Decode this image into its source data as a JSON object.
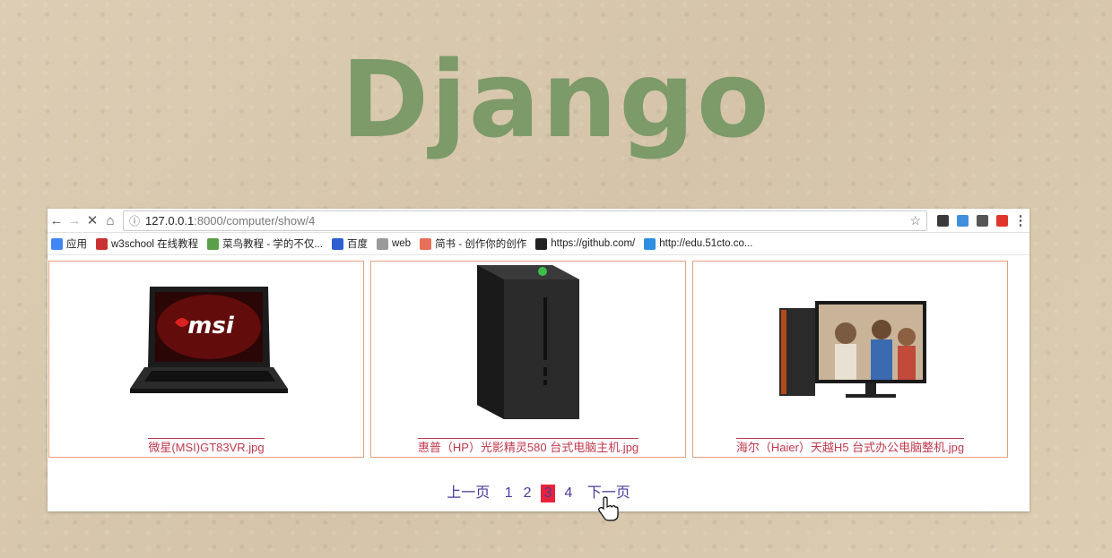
{
  "slide": {
    "title": "Django"
  },
  "browser": {
    "url_host": "127.0.0.1",
    "url_path": ":8000/computer/show/4",
    "bookmarks": [
      {
        "label": "应用",
        "icon": "apps-grid-icon",
        "color": "#4285f4"
      },
      {
        "label": "w3school 在线教程",
        "icon": "w3school-icon",
        "color": "#c83232"
      },
      {
        "label": "菜鸟教程 - 学的不仅...",
        "icon": "runoob-icon",
        "color": "#5aa04a"
      },
      {
        "label": "百度",
        "icon": "baidu-paw-icon",
        "color": "#2e5fcf"
      },
      {
        "label": "web",
        "icon": "folder-icon",
        "color": "#9a9a9a"
      },
      {
        "label": "简书 - 创作你的创作",
        "icon": "jianshu-icon",
        "color": "#ea6f5a"
      },
      {
        "label": "https://github.com/",
        "icon": "github-icon",
        "color": "#222222"
      },
      {
        "label": "http://edu.51cto.co...",
        "icon": "51cto-icon",
        "color": "#2d8fe0"
      }
    ],
    "extensions": [
      {
        "name": "evernote-icon",
        "color": "#3a3a3a"
      },
      {
        "name": "translate-icon",
        "color": "#3f8fdc"
      },
      {
        "name": "qrcode-icon",
        "color": "#555555"
      },
      {
        "name": "opera-icon",
        "color": "#e0352b"
      }
    ]
  },
  "products": [
    {
      "caption": "微星(MSI)GT83VR.jpg",
      "image": "msi-laptop-image"
    },
    {
      "caption": "惠普（HP）光影精灵580 台式电脑主机.jpg",
      "image": "hp-tower-image"
    },
    {
      "caption": "海尔（Haier）天越H5 台式办公电脑整机.jpg",
      "image": "haier-desktop-image"
    }
  ],
  "pager": {
    "prev": "上一页",
    "pages": [
      "1",
      "2",
      "3",
      "4"
    ],
    "active": "3",
    "next": "下一页"
  },
  "colors": {
    "title": "#7d9a69",
    "card_border": "#e8a07a",
    "link": "#c0394d",
    "active_page": "#e8223a"
  }
}
